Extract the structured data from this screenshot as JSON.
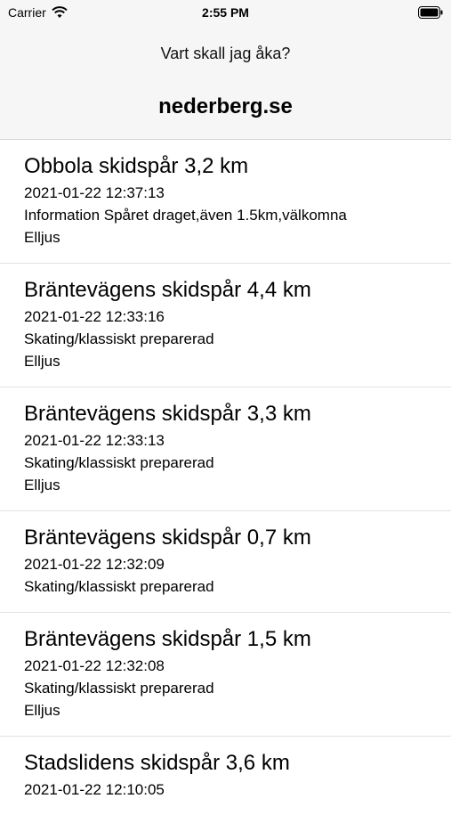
{
  "status_bar": {
    "carrier": "Carrier",
    "time": "2:55 PM"
  },
  "nav": {
    "prompt": "Vart skall jag åka?",
    "title": "nederberg.se"
  },
  "trails": [
    {
      "name": "Obbola skidspår 3,2 km",
      "updated": "2021-01-22 12:37:13",
      "info": "Information Spåret draget,även 1.5km,välkomna",
      "light": "Elljus"
    },
    {
      "name": "Bräntevägens skidspår 4,4 km",
      "updated": "2021-01-22 12:33:16",
      "info": "Skating/klassiskt preparerad",
      "light": "Elljus"
    },
    {
      "name": "Bräntevägens skidspår 3,3 km",
      "updated": "2021-01-22 12:33:13",
      "info": "Skating/klassiskt preparerad",
      "light": "Elljus"
    },
    {
      "name": "Bräntevägens skidspår 0,7 km",
      "updated": "2021-01-22 12:32:09",
      "info": "Skating/klassiskt preparerad",
      "light": ""
    },
    {
      "name": "Bräntevägens skidspår 1,5 km",
      "updated": "2021-01-22 12:32:08",
      "info": "Skating/klassiskt preparerad",
      "light": "Elljus"
    },
    {
      "name": "Stadslidens skidspår 3,6 km",
      "updated": "2021-01-22 12:10:05",
      "info": "",
      "light": ""
    }
  ]
}
